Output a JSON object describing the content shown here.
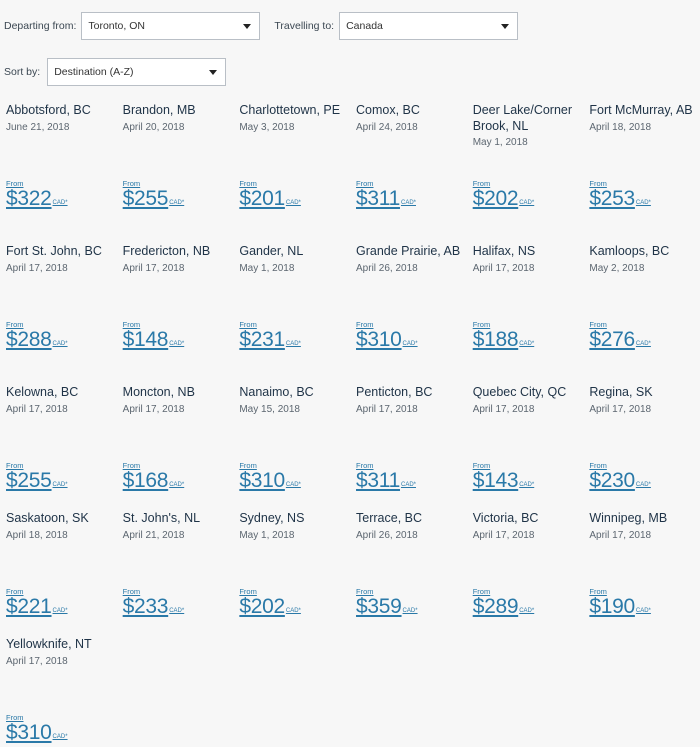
{
  "filters": {
    "departing_label": "Departing from:",
    "departing_value": "Toronto, ON",
    "travelling_label": "Travelling to:",
    "travelling_value": "Canada",
    "sort_label": "Sort by:",
    "sort_value": "Destination (A-Z)"
  },
  "price_from_label": "From",
  "currency_label": "CAD*",
  "destinations": [
    {
      "name": "Abbotsford, BC",
      "date": "June 21, 2018",
      "price": "$322"
    },
    {
      "name": "Brandon, MB",
      "date": "April 20, 2018",
      "price": "$255"
    },
    {
      "name": "Charlottetown, PE",
      "date": "May 3, 2018",
      "price": "$201"
    },
    {
      "name": "Comox, BC",
      "date": "April 24, 2018",
      "price": "$311"
    },
    {
      "name": "Deer Lake/Corner Brook, NL",
      "date": "May 1, 2018",
      "price": "$202"
    },
    {
      "name": "Fort McMurray, AB",
      "date": "April 18, 2018",
      "price": "$253"
    },
    {
      "name": "Fort St. John, BC",
      "date": "April 17, 2018",
      "price": "$288"
    },
    {
      "name": "Fredericton, NB",
      "date": "April 17, 2018",
      "price": "$148"
    },
    {
      "name": "Gander, NL",
      "date": "May 1, 2018",
      "price": "$231"
    },
    {
      "name": "Grande Prairie, AB",
      "date": "April 26, 2018",
      "price": "$310"
    },
    {
      "name": "Halifax, NS",
      "date": "April 17, 2018",
      "price": "$188"
    },
    {
      "name": "Kamloops, BC",
      "date": "May 2, 2018",
      "price": "$276"
    },
    {
      "name": "Kelowna, BC",
      "date": "April 17, 2018",
      "price": "$255"
    },
    {
      "name": "Moncton, NB",
      "date": "April 17, 2018",
      "price": "$168"
    },
    {
      "name": "Nanaimo, BC",
      "date": "May 15, 2018",
      "price": "$310"
    },
    {
      "name": "Penticton, BC",
      "date": "April 17, 2018",
      "price": "$311"
    },
    {
      "name": "Quebec City, QC",
      "date": "April 17, 2018",
      "price": "$143"
    },
    {
      "name": "Regina, SK",
      "date": "April 17, 2018",
      "price": "$230"
    },
    {
      "name": "Saskatoon, SK",
      "date": "April 18, 2018",
      "price": "$221"
    },
    {
      "name": "St. John's, NL",
      "date": "April 21, 2018",
      "price": "$233"
    },
    {
      "name": "Sydney, NS",
      "date": "May 1, 2018",
      "price": "$202"
    },
    {
      "name": "Terrace, BC",
      "date": "April 26, 2018",
      "price": "$359"
    },
    {
      "name": "Victoria, BC",
      "date": "April 17, 2018",
      "price": "$289"
    },
    {
      "name": "Winnipeg, MB",
      "date": "April 17, 2018",
      "price": "$190"
    },
    {
      "name": "Yellowknife, NT",
      "date": "April 17, 2018",
      "price": "$310"
    }
  ]
}
